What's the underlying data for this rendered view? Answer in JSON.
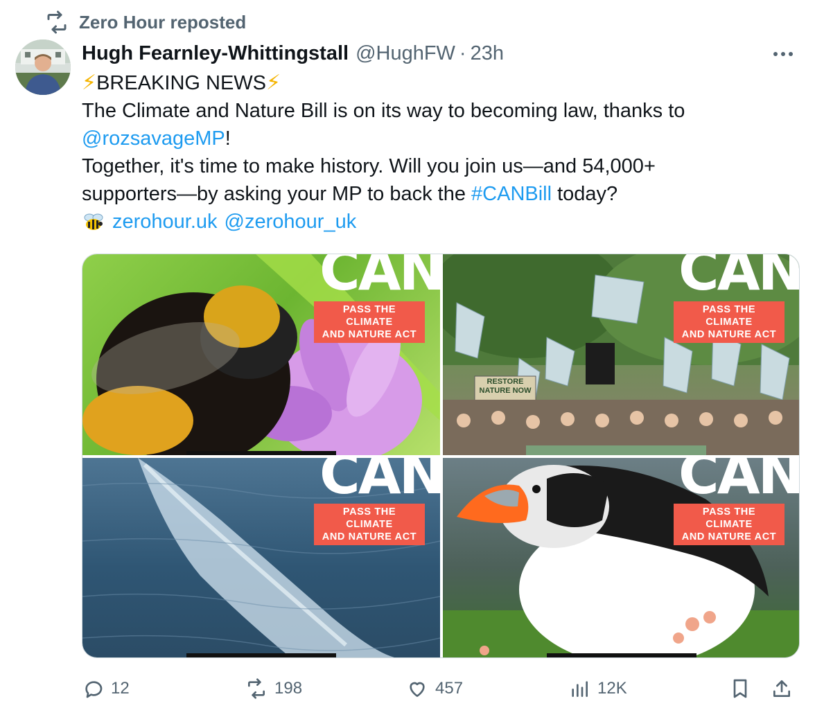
{
  "repost": {
    "text": "Zero Hour reposted"
  },
  "author": {
    "name": "Hugh Fearnley-Whittingstall",
    "handle": "@HughFW",
    "separator": "·",
    "time": "23h"
  },
  "tweet": {
    "line1": "BREAKING NEWS",
    "line2": "The Climate and Nature Bill is on its way to becoming law, thanks to",
    "mention": "@rozsavageMP",
    "mention_suffix": "!",
    "line4": "Together, it's time to make history. Will you join us—and 54,000+",
    "line5_pre": "supporters—by asking your MP to back the ",
    "hashtag": "#CANBill",
    "line5_post": " today?",
    "link1": "zerohour.uk",
    "link2": "@zerohour_uk"
  },
  "media": {
    "headline": "CAN",
    "badge_line1": "PASS THE CLIMATE",
    "badge_line2": "AND NATURE ACT",
    "protest_sign": "RESTORE NATURE NOW"
  },
  "actions": {
    "replies": "12",
    "reposts": "198",
    "likes": "457",
    "views": "12K"
  },
  "colors": {
    "accent": "#1d9bf0",
    "muted": "#536471",
    "badge": "#f15a4a"
  },
  "icons": [
    "repost-icon",
    "more-icon",
    "zap-icon",
    "bee-icon",
    "reply-icon",
    "like-icon",
    "views-icon",
    "bookmark-icon",
    "share-icon"
  ]
}
